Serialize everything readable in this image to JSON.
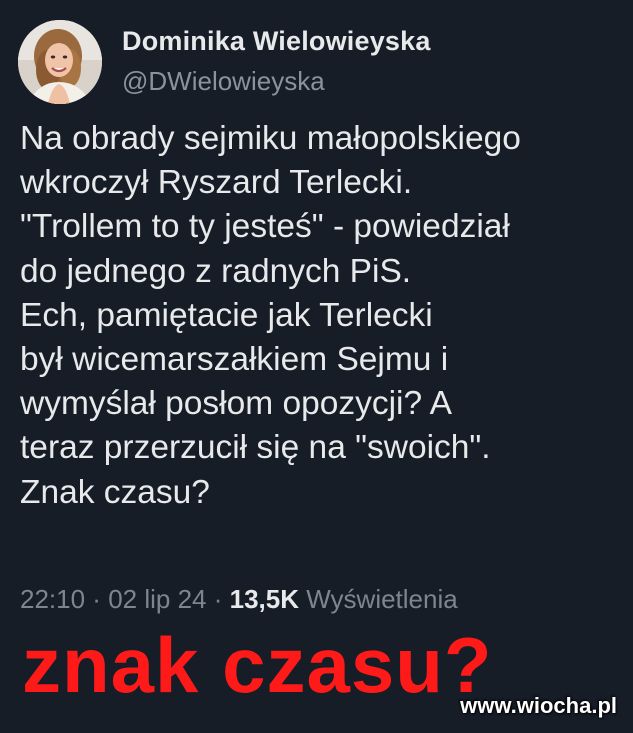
{
  "author": {
    "display_name": "Dominika Wielowieyska",
    "handle": "@DWielowieyska",
    "avatar_icon": "profile-photo"
  },
  "tweet": {
    "lines": [
      "Na obrady sejmiku małopolskiego",
      "wkroczył Ryszard Terlecki.",
      "\"Trollem to ty jesteś\" - powiedział",
      "do jednego z radnych PiS.",
      "Ech, pamiętacie jak Terlecki",
      "był wicemarszałkiem Sejmu i",
      "wymyślał posłom opozycji? A",
      "teraz przerzucił się na \"swoich\".",
      "Znak czasu?"
    ]
  },
  "meta": {
    "time": "22:10",
    "separator": " · ",
    "date": "02 lip 24",
    "views_count": "13,5K",
    "views_label": "Wyświetlenia"
  },
  "overlay": {
    "caption": "znak czasu?",
    "caption_color": "#ff1a1a",
    "watermark": "www.wiocha.pl"
  },
  "colors": {
    "background": "#161d27",
    "text": "#e7e9ea",
    "muted": "#8a939c"
  }
}
